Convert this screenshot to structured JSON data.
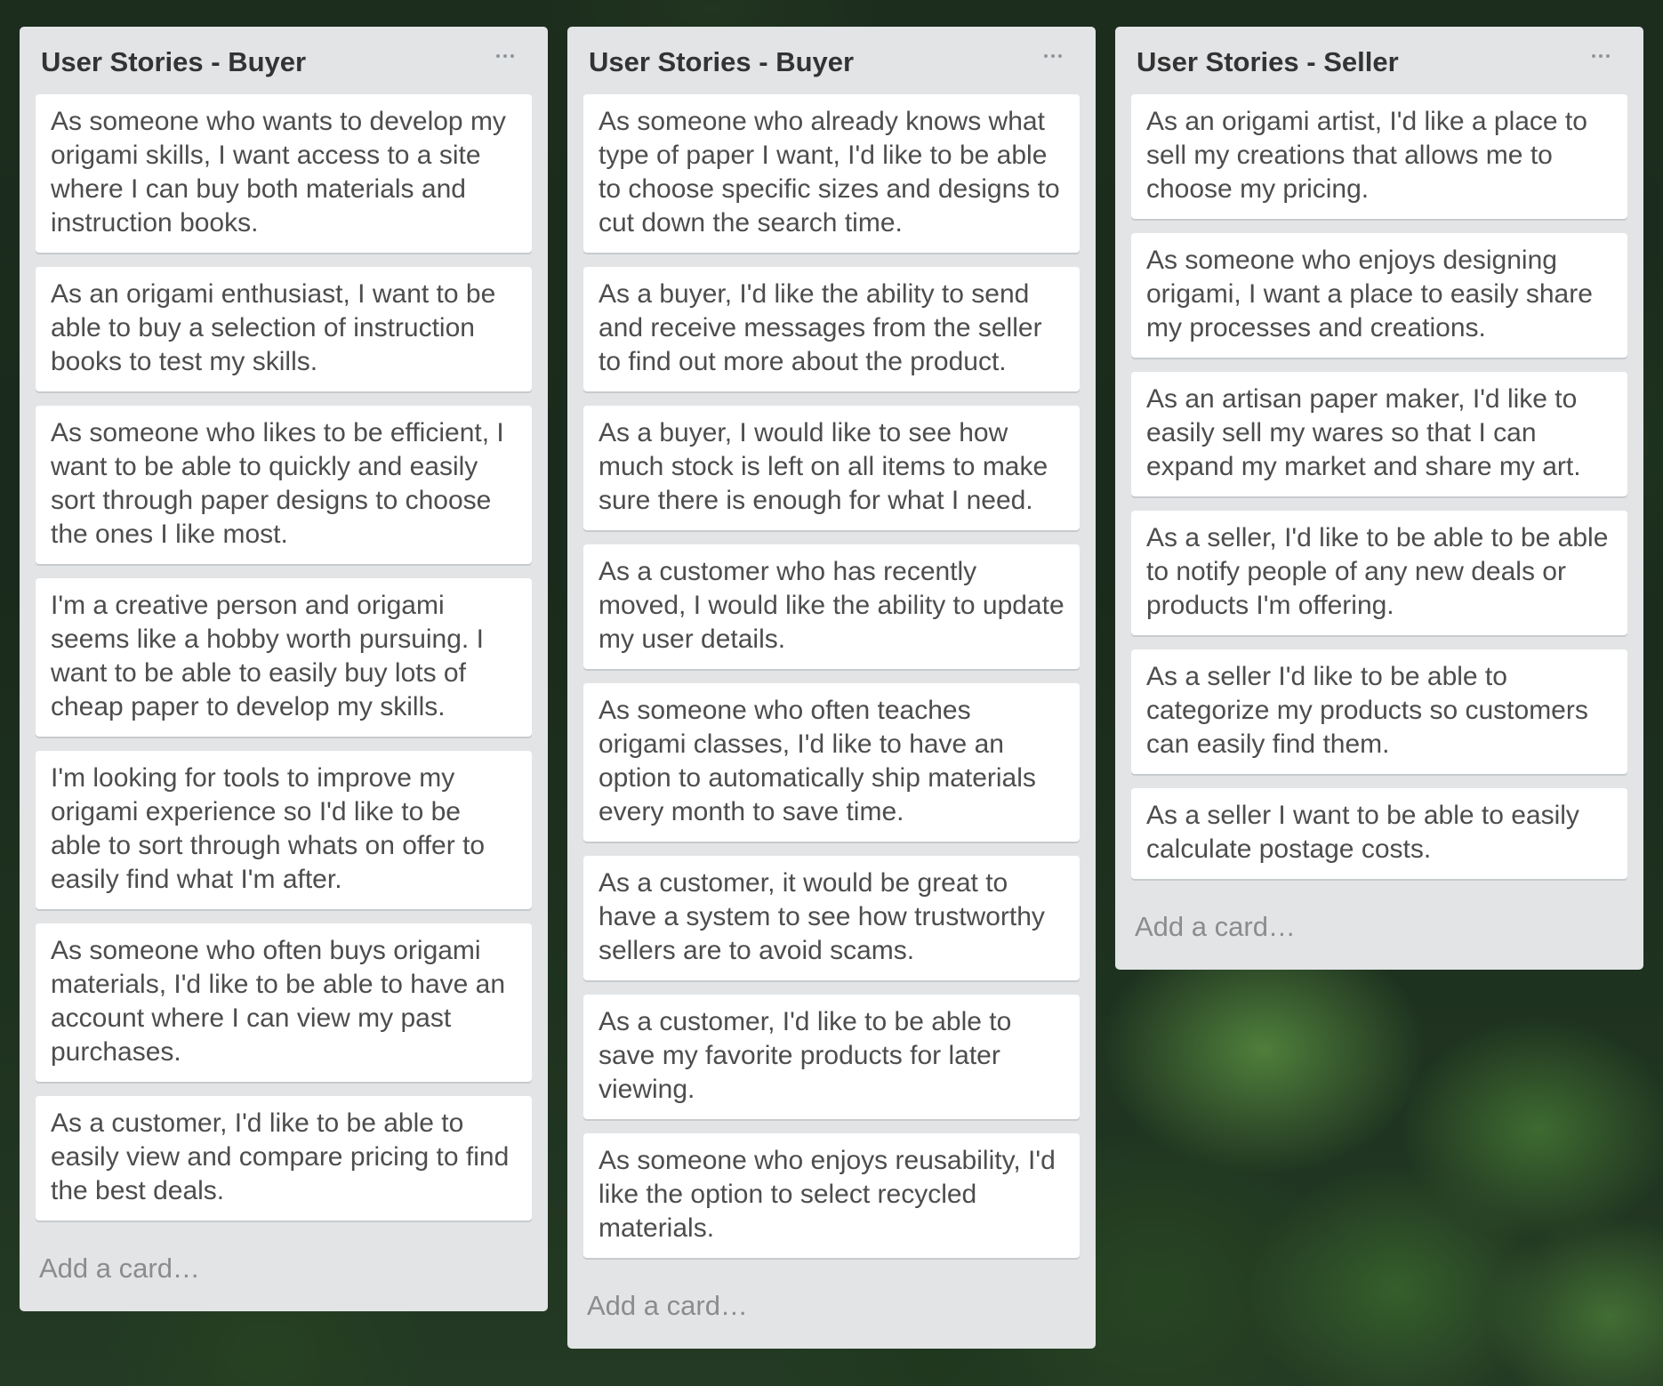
{
  "board": {
    "lists": [
      {
        "title": "User Stories - Buyer",
        "menu_icon": "more-horizontal-icon",
        "cards": [
          "As someone who wants to develop my origami skills, I want access to a site where I can buy both materials and instruction books.",
          "As an origami enthusiast, I want to be able to buy a selection of instruction books to test my skills.",
          "As someone who likes to be efficient, I want to be able to quickly and easily sort through paper designs to choose the ones I like most.",
          "I'm a creative person and origami seems like a hobby worth pursuing. I want to be able to easily buy lots of cheap paper to develop my skills.",
          "I'm looking for tools to improve my origami experience so I'd like to be able to sort through whats on offer to easily find what I'm after.",
          "As someone who often buys origami materials, I'd like to be able to have an account where I can view my past purchases.",
          "As a customer, I'd like to be able to easily view and compare pricing to find the best deals."
        ],
        "add_card_label": "Add a card…"
      },
      {
        "title": "User Stories - Buyer",
        "menu_icon": "more-horizontal-icon",
        "cards": [
          "As someone who already knows what type of paper I want, I'd like to be able to choose specific sizes and designs to cut down the search time.",
          "As a buyer, I'd like the ability to send and receive messages from the seller to find out more about the product.",
          "As a buyer, I would like to see how much stock is left on all items to make sure there is enough for what I need.",
          "As a customer who has recently moved, I would like the ability to update my user details.",
          "As someone who often teaches origami classes, I'd like to have an option to automatically ship materials every month to save time.",
          "As a customer, it would be great to have a system to see how trustworthy sellers are to avoid scams.",
          "As a customer, I'd like to be able to save my favorite products for later viewing.",
          "As someone who enjoys reusability, I'd like the option to select recycled materials."
        ],
        "add_card_label": "Add a card…"
      },
      {
        "title": "User Stories - Seller",
        "menu_icon": "more-horizontal-icon",
        "cards": [
          "As an origami artist, I'd like a place to sell my creations that allows me to choose my pricing.",
          "As someone who enjoys designing origami, I want a place to easily share my processes and creations.",
          "As an artisan paper maker, I'd like to easily sell my wares so that I can expand my market and share my art.",
          "As a seller, I'd like to be able to be able to notify people of any new deals or products I'm offering.",
          "As a seller I'd like to be able to categorize my products so customers can easily find them.",
          "As a seller I want to be able to easily calculate postage costs."
        ],
        "add_card_label": "Add a card…"
      }
    ]
  },
  "colors": {
    "list_background": "#e2e4e6",
    "card_background": "#ffffff",
    "card_text": "#4d4d4d",
    "title_text": "#333333",
    "add_card_text": "#8c8c8c"
  }
}
